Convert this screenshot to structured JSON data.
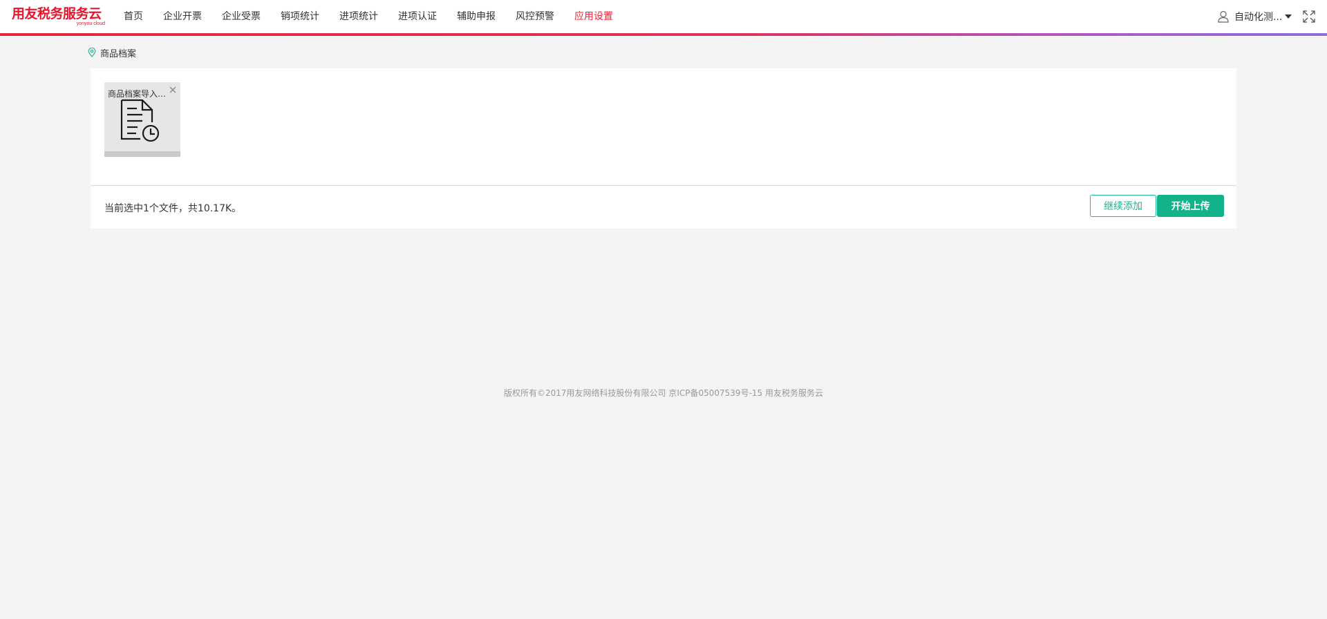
{
  "header": {
    "logo_text": "用友税务服务云",
    "logo_sub": "yonyou cloud",
    "nav": [
      {
        "label": "首页",
        "active": false
      },
      {
        "label": "企业开票",
        "active": false
      },
      {
        "label": "企业受票",
        "active": false
      },
      {
        "label": "销项统计",
        "active": false
      },
      {
        "label": "进项统计",
        "active": false
      },
      {
        "label": "进项认证",
        "active": false
      },
      {
        "label": "辅助申报",
        "active": false
      },
      {
        "label": "风控预警",
        "active": false
      },
      {
        "label": "应用设置",
        "active": true
      }
    ],
    "user_name": "自动化测...",
    "user_icon": "user-icon",
    "fullscreen_icon": "fullscreen-icon",
    "accent_color": "#e8263a"
  },
  "breadcrumb": {
    "icon": "location-pin-icon",
    "label": "商品档案"
  },
  "upload": {
    "file": {
      "name": "商品档案导入模板.xlsx",
      "icon": "document-pending-icon",
      "close_icon": "close-icon"
    },
    "status_text": "当前选中1个文件，共10.17K。",
    "continue_label": "继续添加",
    "start_label": "开始上传",
    "primary_color": "#12b28b"
  },
  "footer": {
    "text": "版权所有©2017用友网络科技股份有限公司  京ICP备05007539号-15  用友税务服务云"
  }
}
